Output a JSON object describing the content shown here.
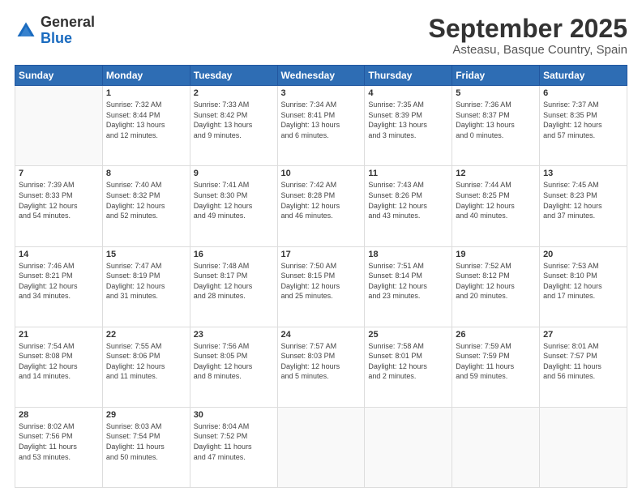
{
  "logo": {
    "general": "General",
    "blue": "Blue"
  },
  "header": {
    "title": "September 2025",
    "subtitle": "Asteasu, Basque Country, Spain"
  },
  "weekdays": [
    "Sunday",
    "Monday",
    "Tuesday",
    "Wednesday",
    "Thursday",
    "Friday",
    "Saturday"
  ],
  "weeks": [
    [
      {
        "day": "",
        "info": ""
      },
      {
        "day": "1",
        "info": "Sunrise: 7:32 AM\nSunset: 8:44 PM\nDaylight: 13 hours\nand 12 minutes."
      },
      {
        "day": "2",
        "info": "Sunrise: 7:33 AM\nSunset: 8:42 PM\nDaylight: 13 hours\nand 9 minutes."
      },
      {
        "day": "3",
        "info": "Sunrise: 7:34 AM\nSunset: 8:41 PM\nDaylight: 13 hours\nand 6 minutes."
      },
      {
        "day": "4",
        "info": "Sunrise: 7:35 AM\nSunset: 8:39 PM\nDaylight: 13 hours\nand 3 minutes."
      },
      {
        "day": "5",
        "info": "Sunrise: 7:36 AM\nSunset: 8:37 PM\nDaylight: 13 hours\nand 0 minutes."
      },
      {
        "day": "6",
        "info": "Sunrise: 7:37 AM\nSunset: 8:35 PM\nDaylight: 12 hours\nand 57 minutes."
      }
    ],
    [
      {
        "day": "7",
        "info": "Sunrise: 7:39 AM\nSunset: 8:33 PM\nDaylight: 12 hours\nand 54 minutes."
      },
      {
        "day": "8",
        "info": "Sunrise: 7:40 AM\nSunset: 8:32 PM\nDaylight: 12 hours\nand 52 minutes."
      },
      {
        "day": "9",
        "info": "Sunrise: 7:41 AM\nSunset: 8:30 PM\nDaylight: 12 hours\nand 49 minutes."
      },
      {
        "day": "10",
        "info": "Sunrise: 7:42 AM\nSunset: 8:28 PM\nDaylight: 12 hours\nand 46 minutes."
      },
      {
        "day": "11",
        "info": "Sunrise: 7:43 AM\nSunset: 8:26 PM\nDaylight: 12 hours\nand 43 minutes."
      },
      {
        "day": "12",
        "info": "Sunrise: 7:44 AM\nSunset: 8:25 PM\nDaylight: 12 hours\nand 40 minutes."
      },
      {
        "day": "13",
        "info": "Sunrise: 7:45 AM\nSunset: 8:23 PM\nDaylight: 12 hours\nand 37 minutes."
      }
    ],
    [
      {
        "day": "14",
        "info": "Sunrise: 7:46 AM\nSunset: 8:21 PM\nDaylight: 12 hours\nand 34 minutes."
      },
      {
        "day": "15",
        "info": "Sunrise: 7:47 AM\nSunset: 8:19 PM\nDaylight: 12 hours\nand 31 minutes."
      },
      {
        "day": "16",
        "info": "Sunrise: 7:48 AM\nSunset: 8:17 PM\nDaylight: 12 hours\nand 28 minutes."
      },
      {
        "day": "17",
        "info": "Sunrise: 7:50 AM\nSunset: 8:15 PM\nDaylight: 12 hours\nand 25 minutes."
      },
      {
        "day": "18",
        "info": "Sunrise: 7:51 AM\nSunset: 8:14 PM\nDaylight: 12 hours\nand 23 minutes."
      },
      {
        "day": "19",
        "info": "Sunrise: 7:52 AM\nSunset: 8:12 PM\nDaylight: 12 hours\nand 20 minutes."
      },
      {
        "day": "20",
        "info": "Sunrise: 7:53 AM\nSunset: 8:10 PM\nDaylight: 12 hours\nand 17 minutes."
      }
    ],
    [
      {
        "day": "21",
        "info": "Sunrise: 7:54 AM\nSunset: 8:08 PM\nDaylight: 12 hours\nand 14 minutes."
      },
      {
        "day": "22",
        "info": "Sunrise: 7:55 AM\nSunset: 8:06 PM\nDaylight: 12 hours\nand 11 minutes."
      },
      {
        "day": "23",
        "info": "Sunrise: 7:56 AM\nSunset: 8:05 PM\nDaylight: 12 hours\nand 8 minutes."
      },
      {
        "day": "24",
        "info": "Sunrise: 7:57 AM\nSunset: 8:03 PM\nDaylight: 12 hours\nand 5 minutes."
      },
      {
        "day": "25",
        "info": "Sunrise: 7:58 AM\nSunset: 8:01 PM\nDaylight: 12 hours\nand 2 minutes."
      },
      {
        "day": "26",
        "info": "Sunrise: 7:59 AM\nSunset: 7:59 PM\nDaylight: 11 hours\nand 59 minutes."
      },
      {
        "day": "27",
        "info": "Sunrise: 8:01 AM\nSunset: 7:57 PM\nDaylight: 11 hours\nand 56 minutes."
      }
    ],
    [
      {
        "day": "28",
        "info": "Sunrise: 8:02 AM\nSunset: 7:56 PM\nDaylight: 11 hours\nand 53 minutes."
      },
      {
        "day": "29",
        "info": "Sunrise: 8:03 AM\nSunset: 7:54 PM\nDaylight: 11 hours\nand 50 minutes."
      },
      {
        "day": "30",
        "info": "Sunrise: 8:04 AM\nSunset: 7:52 PM\nDaylight: 11 hours\nand 47 minutes."
      },
      {
        "day": "",
        "info": ""
      },
      {
        "day": "",
        "info": ""
      },
      {
        "day": "",
        "info": ""
      },
      {
        "day": "",
        "info": ""
      }
    ]
  ]
}
